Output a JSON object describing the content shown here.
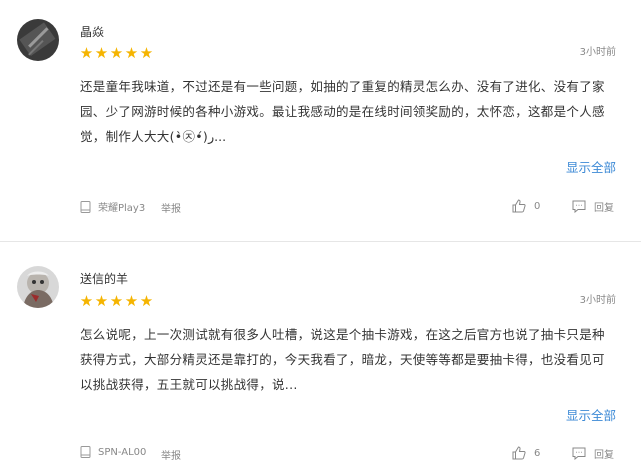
{
  "reviews": [
    {
      "username": "晶焱",
      "stars": "★★★★★",
      "time": "3小时前",
      "content": "还是童年我味道，不过还是有一些问题，如抽的了重复的精灵怎么办、没有了进化、没有了家园、少了网游时候的各种小游戏。最让我感动的是在线时间领奖励的，太怀恋，这都是个人感觉，制作人大大(•̀㉨•́)ر...",
      "show_all": "显示全部",
      "device": "荣耀Play3",
      "report": "举报",
      "likes": "0",
      "reply": "回复"
    },
    {
      "username": "送信的羊",
      "stars": "★★★★★",
      "time": "3小时前",
      "content": "怎么说呢，上一次测试就有很多人吐槽，说这是个抽卡游戏，在这之后官方也说了抽卡只是种获得方式，大部分精灵还是靠打的，今天我看了，暗龙，天使等等都是要抽卡得，也没看见可以挑战获得，五王就可以挑战得，说...",
      "show_all": "显示全部",
      "device": "SPN-AL00",
      "report": "举报",
      "likes": "6",
      "reply": "回复"
    }
  ],
  "colors": {
    "accent": "#3d8ad6",
    "star": "#f5b400",
    "muted": "#888888"
  }
}
